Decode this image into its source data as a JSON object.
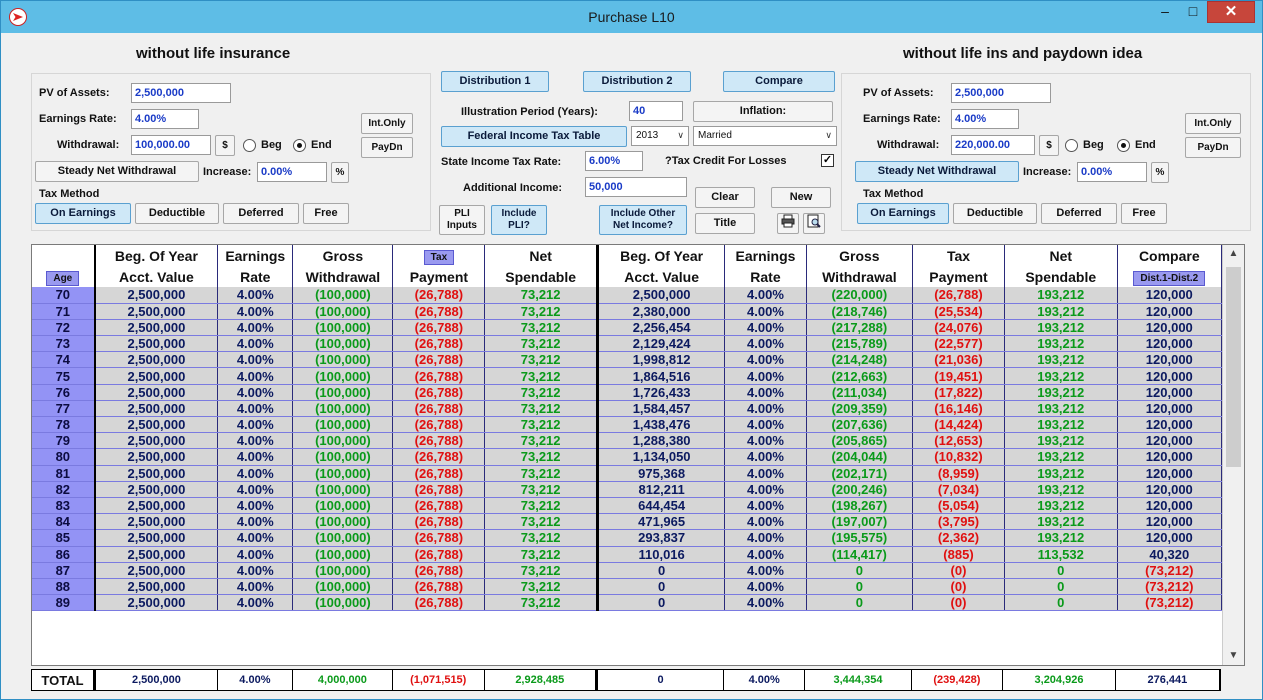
{
  "window": {
    "title": "Purchase L10"
  },
  "left": {
    "title": "without life insurance",
    "pv_label": "PV of Assets:",
    "pv_value": "2,500,000",
    "rate_label": "Earnings Rate:",
    "rate_value": "4.00%",
    "withdrawal_label": "Withdrawal:",
    "withdrawal_value": "100,000.00",
    "dollar_btn": "$",
    "beg_label": "Beg",
    "end_label": "End",
    "intonly": "Int.Only",
    "paydn": "PayDn",
    "steady": "Steady Net Withdrawal",
    "increase_label": "Increase:",
    "increase_value": "0.00%",
    "pct_btn": "%",
    "taxmethod_label": "Tax Method",
    "tm_earnings": "On Earnings",
    "tm_deductible": "Deductible",
    "tm_deferred": "Deferred",
    "tm_free": "Free"
  },
  "right": {
    "title": "without life ins and paydown idea",
    "pv_label": "PV of Assets:",
    "pv_value": "2,500,000",
    "rate_label": "Earnings Rate:",
    "rate_value": "4.00%",
    "withdrawal_label": "Withdrawal:",
    "withdrawal_value": "220,000.00",
    "dollar_btn": "$",
    "beg_label": "Beg",
    "end_label": "End",
    "intonly": "Int.Only",
    "paydn": "PayDn",
    "steady": "Steady Net Withdrawal",
    "increase_label": "Increase:",
    "increase_value": "0.00%",
    "pct_btn": "%",
    "taxmethod_label": "Tax Method",
    "tm_earnings": "On Earnings",
    "tm_deductible": "Deductible",
    "tm_deferred": "Deferred",
    "tm_free": "Free"
  },
  "center": {
    "dist1": "Distribution 1",
    "dist2": "Distribution 2",
    "compare": "Compare",
    "period_label": "Illustration Period (Years):",
    "period_value": "40",
    "inflation": "Inflation:",
    "fed_table": "Federal Income Tax Table",
    "year_value": "2013",
    "status_value": "Married",
    "state_label": "State Income Tax Rate:",
    "state_value": "6.00%",
    "credit_label": "?Tax Credit For Losses",
    "credit_check": "✓",
    "addl_label": "Additional Income:",
    "addl_value": "50,000",
    "clear": "Clear",
    "new": "New",
    "title_btn": "Title",
    "pli_inputs_1": "PLI",
    "pli_inputs_2": "Inputs",
    "include_pli_1": "Include",
    "include_pli_2": "PLI?",
    "include_other_1": "Include Other",
    "include_other_2": "Net Income?"
  },
  "table": {
    "headers_top": [
      "",
      "Beg. Of Year",
      "Earnings",
      "Gross",
      "Tax",
      "Net",
      "Beg. Of Year",
      "Earnings",
      "Gross",
      "Tax",
      "Net",
      "Compare"
    ],
    "headers_bottom": [
      "Age",
      "Acct. Value",
      "Rate",
      "Withdrawal",
      "Payment",
      "Spendable",
      "Acct. Value",
      "Rate",
      "Withdrawal",
      "Payment",
      "Spendable",
      "Dist.1-Dist.2"
    ],
    "rows": [
      [
        "70",
        "2,500,000",
        "4.00%",
        "(100,000)",
        "(26,788)",
        "73,212",
        "2,500,000",
        "4.00%",
        "(220,000)",
        "(26,788)",
        "193,212",
        "120,000"
      ],
      [
        "71",
        "2,500,000",
        "4.00%",
        "(100,000)",
        "(26,788)",
        "73,212",
        "2,380,000",
        "4.00%",
        "(218,746)",
        "(25,534)",
        "193,212",
        "120,000"
      ],
      [
        "72",
        "2,500,000",
        "4.00%",
        "(100,000)",
        "(26,788)",
        "73,212",
        "2,256,454",
        "4.00%",
        "(217,288)",
        "(24,076)",
        "193,212",
        "120,000"
      ],
      [
        "73",
        "2,500,000",
        "4.00%",
        "(100,000)",
        "(26,788)",
        "73,212",
        "2,129,424",
        "4.00%",
        "(215,789)",
        "(22,577)",
        "193,212",
        "120,000"
      ],
      [
        "74",
        "2,500,000",
        "4.00%",
        "(100,000)",
        "(26,788)",
        "73,212",
        "1,998,812",
        "4.00%",
        "(214,248)",
        "(21,036)",
        "193,212",
        "120,000"
      ],
      [
        "75",
        "2,500,000",
        "4.00%",
        "(100,000)",
        "(26,788)",
        "73,212",
        "1,864,516",
        "4.00%",
        "(212,663)",
        "(19,451)",
        "193,212",
        "120,000"
      ],
      [
        "76",
        "2,500,000",
        "4.00%",
        "(100,000)",
        "(26,788)",
        "73,212",
        "1,726,433",
        "4.00%",
        "(211,034)",
        "(17,822)",
        "193,212",
        "120,000"
      ],
      [
        "77",
        "2,500,000",
        "4.00%",
        "(100,000)",
        "(26,788)",
        "73,212",
        "1,584,457",
        "4.00%",
        "(209,359)",
        "(16,146)",
        "193,212",
        "120,000"
      ],
      [
        "78",
        "2,500,000",
        "4.00%",
        "(100,000)",
        "(26,788)",
        "73,212",
        "1,438,476",
        "4.00%",
        "(207,636)",
        "(14,424)",
        "193,212",
        "120,000"
      ],
      [
        "79",
        "2,500,000",
        "4.00%",
        "(100,000)",
        "(26,788)",
        "73,212",
        "1,288,380",
        "4.00%",
        "(205,865)",
        "(12,653)",
        "193,212",
        "120,000"
      ],
      [
        "80",
        "2,500,000",
        "4.00%",
        "(100,000)",
        "(26,788)",
        "73,212",
        "1,134,050",
        "4.00%",
        "(204,044)",
        "(10,832)",
        "193,212",
        "120,000"
      ],
      [
        "81",
        "2,500,000",
        "4.00%",
        "(100,000)",
        "(26,788)",
        "73,212",
        "975,368",
        "4.00%",
        "(202,171)",
        "(8,959)",
        "193,212",
        "120,000"
      ],
      [
        "82",
        "2,500,000",
        "4.00%",
        "(100,000)",
        "(26,788)",
        "73,212",
        "812,211",
        "4.00%",
        "(200,246)",
        "(7,034)",
        "193,212",
        "120,000"
      ],
      [
        "83",
        "2,500,000",
        "4.00%",
        "(100,000)",
        "(26,788)",
        "73,212",
        "644,454",
        "4.00%",
        "(198,267)",
        "(5,054)",
        "193,212",
        "120,000"
      ],
      [
        "84",
        "2,500,000",
        "4.00%",
        "(100,000)",
        "(26,788)",
        "73,212",
        "471,965",
        "4.00%",
        "(197,007)",
        "(3,795)",
        "193,212",
        "120,000"
      ],
      [
        "85",
        "2,500,000",
        "4.00%",
        "(100,000)",
        "(26,788)",
        "73,212",
        "293,837",
        "4.00%",
        "(195,575)",
        "(2,362)",
        "193,212",
        "120,000"
      ],
      [
        "86",
        "2,500,000",
        "4.00%",
        "(100,000)",
        "(26,788)",
        "73,212",
        "110,016",
        "4.00%",
        "(114,417)",
        "(885)",
        "113,532",
        "40,320"
      ],
      [
        "87",
        "2,500,000",
        "4.00%",
        "(100,000)",
        "(26,788)",
        "73,212",
        "0",
        "4.00%",
        "0",
        "(0)",
        "0",
        "(73,212)"
      ],
      [
        "88",
        "2,500,000",
        "4.00%",
        "(100,000)",
        "(26,788)",
        "73,212",
        "0",
        "4.00%",
        "0",
        "(0)",
        "0",
        "(73,212)"
      ],
      [
        "89",
        "2,500,000",
        "4.00%",
        "(100,000)",
        "(26,788)",
        "73,212",
        "0",
        "4.00%",
        "0",
        "(0)",
        "0",
        "(73,212)"
      ]
    ],
    "totals": [
      "TOTAL",
      "2,500,000",
      "4.00%",
      "4,000,000",
      "(1,071,515)",
      "2,928,485",
      "0",
      "4.00%",
      "3,444,354",
      "(239,428)",
      "3,204,926",
      "276,441"
    ],
    "colors": [
      "age",
      "navy",
      "navy",
      "green",
      "red",
      "green",
      "navy",
      "navy",
      "green",
      "red",
      "green",
      "navy"
    ]
  },
  "icons": {
    "print": "printer-icon",
    "preview": "preview-icon"
  }
}
